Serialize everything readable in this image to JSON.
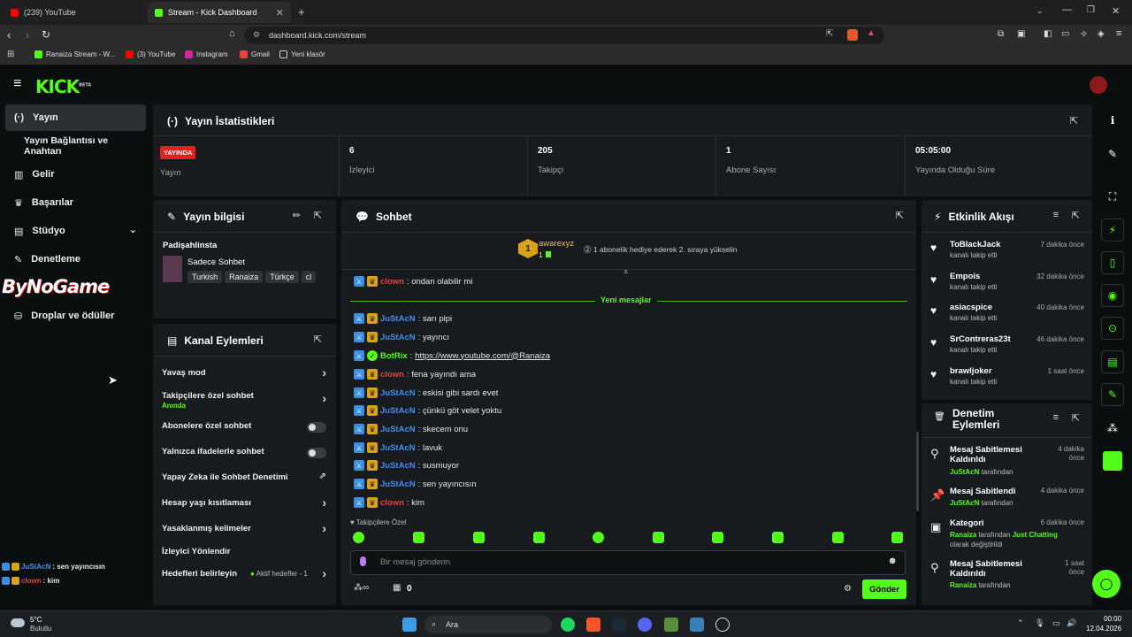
{
  "browser": {
    "tabs": [
      {
        "title": "(239) YouTube",
        "active": false
      },
      {
        "title": "Stream - Kick Dashboard",
        "active": true
      }
    ],
    "url": "dashboard.kick.com/stream",
    "bookmarks": [
      "Ranaiza Stream - W...",
      "(3) YouTube",
      "Instagram",
      "Gmail",
      "Yeni klasör"
    ],
    "colors": {
      "tab_bg": "#1f1f1f",
      "bar_bg": "#2b2b2b"
    }
  },
  "app": {
    "logo": "KICK",
    "logo_sup": "BETA",
    "accent": "#53fc18"
  },
  "sidebar": {
    "items": [
      {
        "label": "Yayın",
        "icon": "broadcast-icon",
        "active": true
      },
      {
        "label": "Yayın Bağlantısı ve Anahtarı",
        "icon": "",
        "active": false
      },
      {
        "label": "Gelir",
        "icon": "chart-icon",
        "active": false
      },
      {
        "label": "Başarılar",
        "icon": "trophy-icon",
        "active": false
      },
      {
        "label": "Stüdyo",
        "icon": "studio-icon",
        "active": false
      },
      {
        "label": "Denetleme",
        "icon": "wrench-icon",
        "active": false
      },
      {
        "label": "Droplar ve ödüller",
        "icon": "drops-icon",
        "active": false
      }
    ],
    "watermark": "ByNoGame",
    "overlay_chat": [
      {
        "user": "JuStAcN",
        "msg": ": sen yayıncısın"
      },
      {
        "user": "clown",
        "msg": ": kim"
      }
    ]
  },
  "stats": {
    "title": "Yayın İstatistikleri",
    "live_badge": "YAYINDA",
    "live_label": "Yayın",
    "items": [
      {
        "value": "6",
        "label": "İzleyici"
      },
      {
        "value": "205",
        "label": "Takipçi"
      },
      {
        "value": "1",
        "label": "Abone Sayısı"
      },
      {
        "value": "05:05:00",
        "label": "Yayında Olduğu Süre"
      }
    ]
  },
  "stream_info": {
    "title": "Yayın bilgisi",
    "stream_name": "Padişahlinsta",
    "category": "Sadece Sohbet",
    "tags": [
      "Turkish",
      "Ranaiza",
      "Türkçe",
      "cl"
    ]
  },
  "channel_actions": {
    "title": "Kanal Eylemleri",
    "rows": [
      {
        "label": "Yavaş mod",
        "control": "chevron"
      },
      {
        "label": "Takipçilere özel sohbet",
        "sub": "Anında",
        "control": "chevron"
      },
      {
        "label": "Abonelere özel sohbet",
        "control": "toggle"
      },
      {
        "label": "Yalnızca ifadelerle sohbet",
        "control": "toggle"
      },
      {
        "label": "Yapay Zeka ile Sohbet Denetimi",
        "control": "external"
      },
      {
        "label": "Hesap yaşı kısıtlaması",
        "control": "chevron"
      },
      {
        "label": "Yasaklanmış kelimeler",
        "control": "chevron"
      },
      {
        "label": "İzleyici Yönlendir",
        "control": "none"
      },
      {
        "label": "Hedefleri belirleyin",
        "status": "Aktif hedefler - 1",
        "control": "chevron"
      }
    ]
  },
  "chat": {
    "title": "Sohbet",
    "pinned_user": "awarexyz",
    "pinned_count": "1",
    "pinned_rank": "1",
    "pinned_note": "1 abonelik hediye ederek 2. sıraya yükselin",
    "new_messages": "Yeni mesajlar",
    "messages": [
      {
        "user": "clown",
        "color": "red",
        "text": ": ondan olabilir mi",
        "badges": [
          "mod",
          "crown"
        ]
      },
      {
        "user": "JuStAcN",
        "color": "blue",
        "text": ": sarı pipi",
        "badges": [
          "mod",
          "crown"
        ]
      },
      {
        "user": "JuStAcN",
        "color": "blue",
        "text": ": yayıncı",
        "badges": [
          "mod",
          "crown"
        ]
      },
      {
        "user": "BotRix",
        "color": "green",
        "text": ": ",
        "link": "https://www.youtube.com/@Ranaiza",
        "badges": [
          "mod",
          "bot"
        ]
      },
      {
        "user": "clown",
        "color": "red",
        "text": ": fena yayındı ama",
        "badges": [
          "mod",
          "crown"
        ]
      },
      {
        "user": "JuStAcN",
        "color": "blue",
        "text": ": eskisi gibi sardı evet",
        "badges": [
          "mod",
          "crown"
        ]
      },
      {
        "user": "JuStAcN",
        "color": "blue",
        "text": ": çünkü göt velet yoktu",
        "badges": [
          "mod",
          "crown"
        ]
      },
      {
        "user": "JuStAcN",
        "color": "blue",
        "text": ": skecem onu",
        "badges": [
          "mod",
          "crown"
        ]
      },
      {
        "user": "JuStAcN",
        "color": "blue",
        "text": ": lavuk",
        "badges": [
          "mod",
          "crown"
        ]
      },
      {
        "user": "JuStAcN",
        "color": "blue",
        "text": ": susmuyor",
        "badges": [
          "mod",
          "crown"
        ]
      },
      {
        "user": "JuStAcN",
        "color": "blue",
        "text": ": sen yayıncısın",
        "badges": [
          "mod",
          "crown"
        ]
      },
      {
        "user": "clown",
        "color": "red",
        "text": ": kim",
        "badges": [
          "mod",
          "crown"
        ]
      }
    ],
    "mode_label": "Takipçilere Özel",
    "input_placeholder": "Bir mesaj gönderin",
    "points": "0",
    "send_label": "Gönder"
  },
  "activity": {
    "title": "Etkinlik Akışı",
    "events": [
      {
        "name": "ToBlackJack",
        "sub": "kanalı takip etti",
        "time": "7 dakika önce"
      },
      {
        "name": "Empois",
        "sub": "kanalı takip etti",
        "time": "32 dakika önce"
      },
      {
        "name": "asiacspice",
        "sub": "kanalı takip etti",
        "time": "40 dakika önce"
      },
      {
        "name": "SrContreras23t",
        "sub": "kanalı takip etti",
        "time": "46 dakika önce"
      },
      {
        "name": "brawljoker",
        "sub": "kanalı takip etti",
        "time": "1 saat önce"
      }
    ]
  },
  "mod_actions": {
    "title": "Denetim Eylemleri",
    "items": [
      {
        "title": "Mesaj Sabitlemesi Kaldırıldı",
        "actor": "JuStAcN",
        "rest": " tarafından",
        "time": "4 dakika önce"
      },
      {
        "title": "Mesaj Sabitlendi",
        "actor": "JuStAcN",
        "rest": " tarafından",
        "time": "4 dakika önce"
      },
      {
        "title": "Kategori",
        "actor": "Ranaiza",
        "rest": " tarafından ",
        "extra": "Just Chatting",
        "rest2": "olarak değiştirildi",
        "time": "6 dakika önce"
      },
      {
        "title": "Mesaj Sabitlemesi Kaldırıldı",
        "actor": "Ranaiza",
        "rest": " tarafından",
        "time": "1 saat önce"
      }
    ]
  },
  "taskbar": {
    "weather_temp": "5°C",
    "weather_text": "Bulutlu",
    "search": "Ara",
    "time": "00:00",
    "date": "12.04.2026"
  }
}
